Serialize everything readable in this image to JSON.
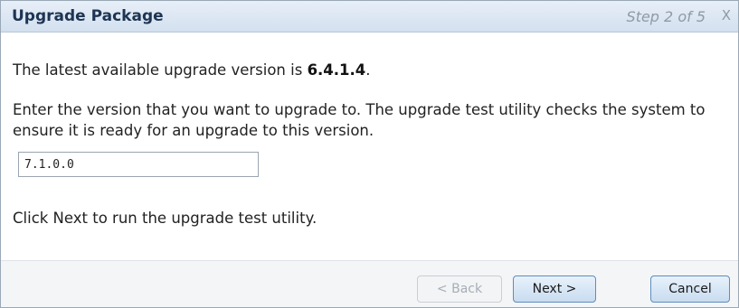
{
  "dialog": {
    "title": "Upgrade Package",
    "step": "Step 2 of 5",
    "close_label": "X"
  },
  "content": {
    "line1_prefix": "The latest available upgrade version is ",
    "latest_version": "6.4.1.4",
    "line1_suffix": ".",
    "instruction": "Enter the version that you want to upgrade to. The upgrade test utility checks the system to ensure it is ready for an upgrade to this version.",
    "version_value": "7.1.0.0",
    "next_hint": "Click Next to run the upgrade test utility."
  },
  "footer": {
    "back_label": "< Back",
    "next_label": "Next >",
    "cancel_label": "Cancel"
  }
}
